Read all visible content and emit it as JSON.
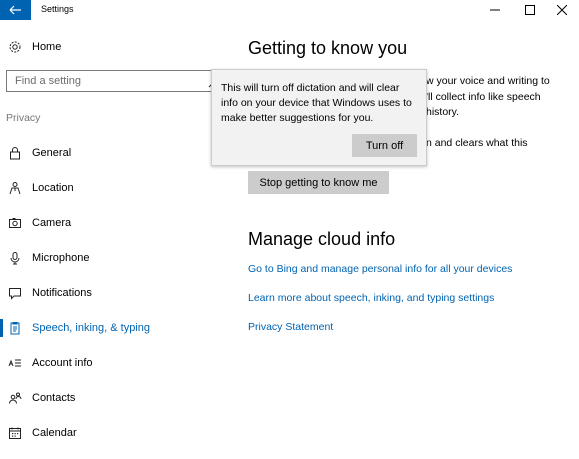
{
  "window": {
    "title": "Settings",
    "controls": [
      "minimize",
      "maximize",
      "close"
    ]
  },
  "sidebar": {
    "home_label": "Home",
    "search": {
      "placeholder": "Find a setting",
      "value": ""
    },
    "group_label": "Privacy",
    "items": [
      {
        "label": "General",
        "icon": "lock-icon",
        "selected": false
      },
      {
        "label": "Location",
        "icon": "location-person-icon",
        "selected": false
      },
      {
        "label": "Camera",
        "icon": "camera-icon",
        "selected": false
      },
      {
        "label": "Microphone",
        "icon": "microphone-icon",
        "selected": false
      },
      {
        "label": "Notifications",
        "icon": "notifications-icon",
        "selected": false
      },
      {
        "label": "Speech, inking, & typing",
        "icon": "clipboard-icon",
        "selected": true
      },
      {
        "label": "Account info",
        "icon": "account-info-icon",
        "selected": false
      },
      {
        "label": "Contacts",
        "icon": "contacts-icon",
        "selected": false
      },
      {
        "label": "Calendar",
        "icon": "calendar-icon",
        "selected": false
      }
    ]
  },
  "main": {
    "section1": {
      "title": "Getting to know you",
      "para1_visible": [
        "w your voice and writing to",
        "'ll collect info like speech",
        "history."
      ],
      "para2_visible": "n and clears what this",
      "button_label": "Stop getting to know me"
    },
    "section2": {
      "title": "Manage cloud info",
      "links": [
        "Go to Bing and manage personal info for all your devices",
        "Learn more about speech, inking, and typing settings",
        "Privacy Statement"
      ]
    }
  },
  "flyout": {
    "message": "This will turn off dictation and will clear info on your device that Windows uses to make better suggestions for you.",
    "button_label": "Turn off"
  },
  "colors": {
    "accent": "#0063b1",
    "button_bg": "#cccccc",
    "flyout_bg": "#f2f2f2",
    "muted_text": "#767676"
  }
}
